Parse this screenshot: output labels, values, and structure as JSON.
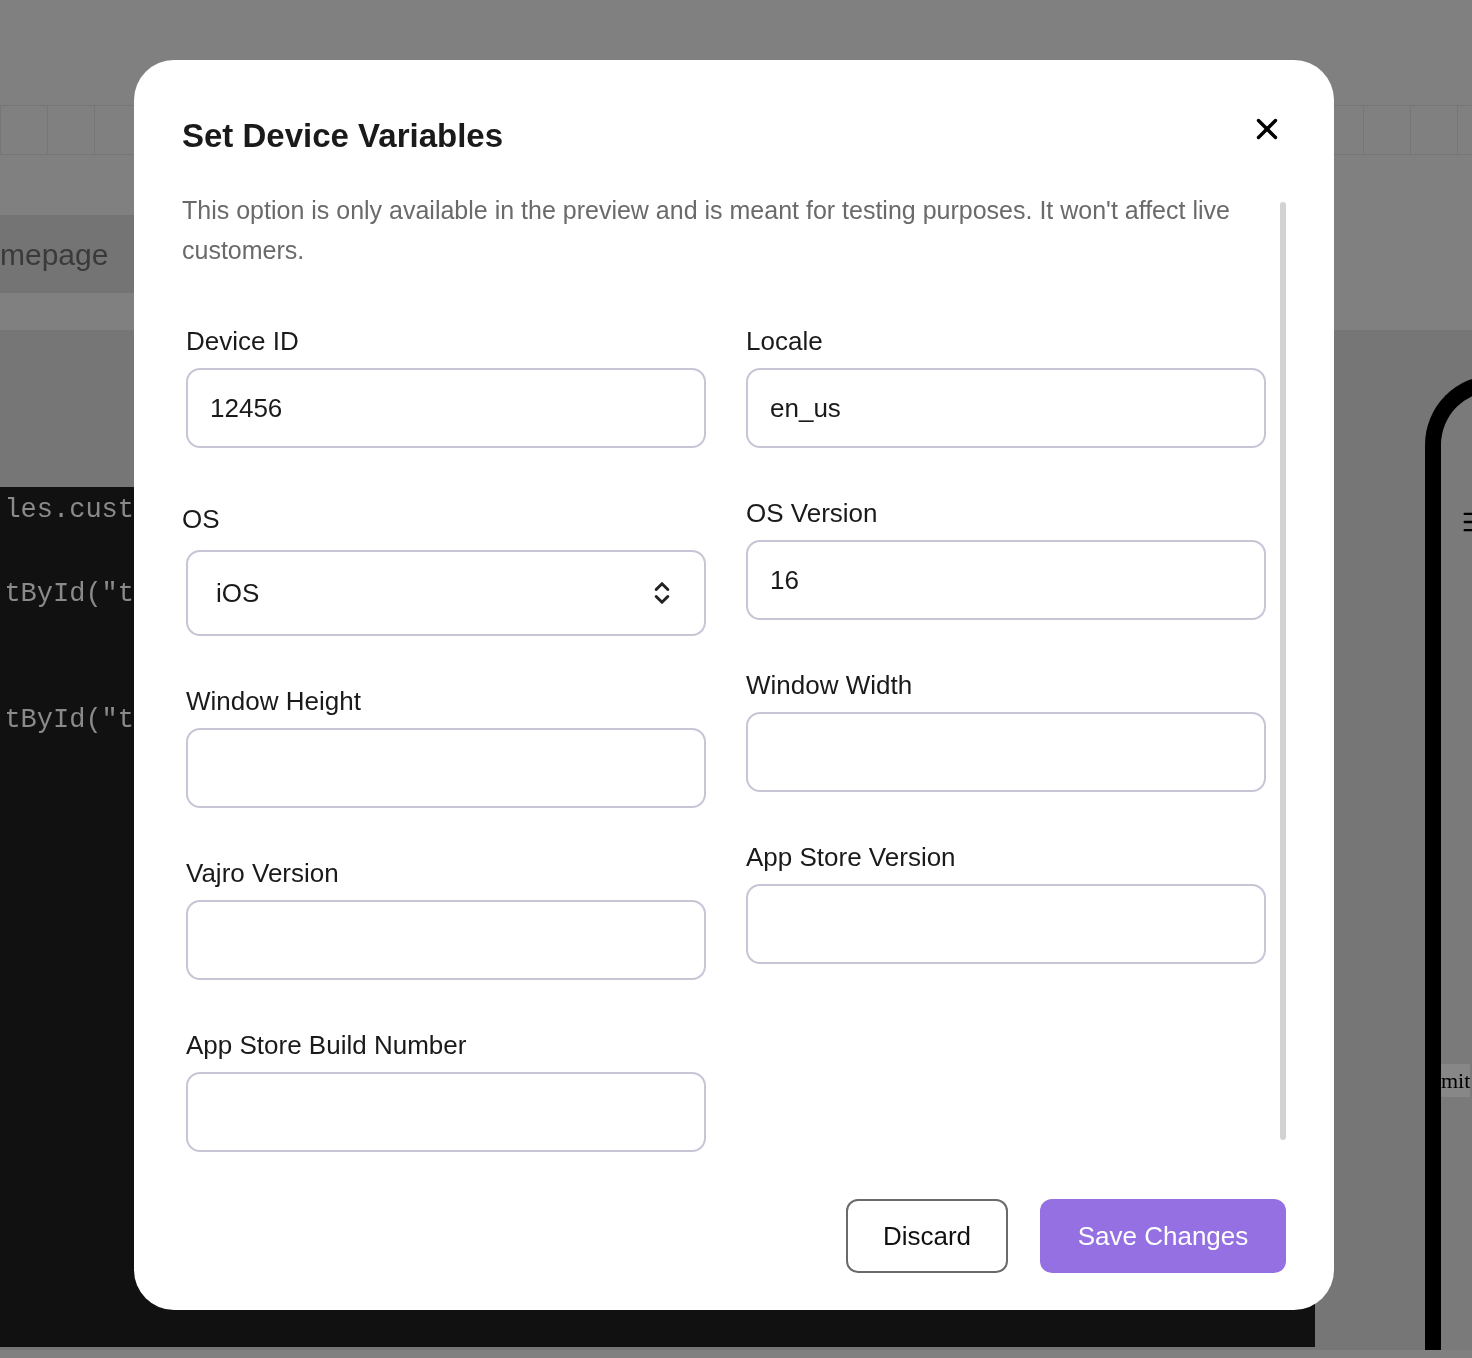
{
  "background": {
    "tab_label": "mepage",
    "code_lines": [
      "les.cust",
      "tById(\"t",
      "tById(\"t"
    ],
    "side_text": "mit"
  },
  "dialog": {
    "title": "Set Device Variables",
    "description": "This option is only available in the preview and is meant for testing purposes. It won't affect live customers.",
    "columns": [
      [
        {
          "kind": "text",
          "label": "Device ID",
          "value": "12456"
        },
        {
          "kind": "select",
          "label": "OS",
          "value": "iOS"
        },
        {
          "kind": "text",
          "label": "Window Height"
        },
        {
          "kind": "text",
          "label": "Vajro Version"
        },
        {
          "kind": "text",
          "label": "App Store Build Number"
        }
      ],
      [
        {
          "kind": "text",
          "label": "Locale",
          "value": "en_us"
        },
        {
          "kind": "text",
          "label": "OS Version",
          "value": "16"
        },
        {
          "kind": "text",
          "label": "Window Width"
        },
        {
          "kind": "text",
          "label": "App Store Version"
        }
      ]
    ],
    "buttons": [
      {
        "kind": "secondary",
        "label": "Discard"
      },
      {
        "kind": "primary",
        "label": "Save Changes"
      }
    ]
  }
}
